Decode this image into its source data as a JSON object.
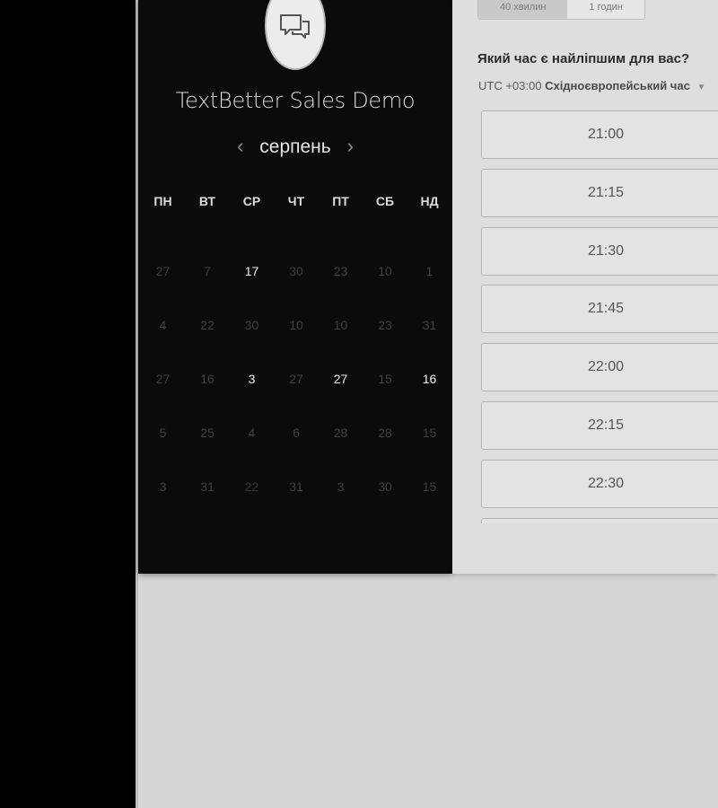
{
  "event": {
    "title": "TextBetter Sales Demo"
  },
  "calendar": {
    "month": "серпень",
    "prev_arrow": "‹",
    "next_arrow": "›",
    "weekdays": [
      "ПН",
      "ВТ",
      "СР",
      "ЧТ",
      "ПТ",
      "СБ",
      "НД"
    ],
    "weeks": [
      [
        {
          "d": "27",
          "a": false
        },
        {
          "d": "7",
          "a": false
        },
        {
          "d": "17",
          "a": true
        },
        {
          "d": "30",
          "a": false
        },
        {
          "d": "23",
          "a": false
        },
        {
          "d": "10",
          "a": false
        },
        {
          "d": "1",
          "a": false
        }
      ],
      [
        {
          "d": "4",
          "a": false
        },
        {
          "d": "22",
          "a": false
        },
        {
          "d": "30",
          "a": false
        },
        {
          "d": "10",
          "a": false
        },
        {
          "d": "10",
          "a": false
        },
        {
          "d": "23",
          "a": false
        },
        {
          "d": "31",
          "a": false
        }
      ],
      [
        {
          "d": "27",
          "a": false
        },
        {
          "d": "16",
          "a": false
        },
        {
          "d": "3",
          "a": true
        },
        {
          "d": "27",
          "a": false
        },
        {
          "d": "27",
          "a": true
        },
        {
          "d": "15",
          "a": false
        },
        {
          "d": "16",
          "a": true
        }
      ],
      [
        {
          "d": "5",
          "a": false
        },
        {
          "d": "25",
          "a": false
        },
        {
          "d": "4",
          "a": false
        },
        {
          "d": "6",
          "a": false
        },
        {
          "d": "28",
          "a": false
        },
        {
          "d": "28",
          "a": false
        },
        {
          "d": "15",
          "a": false
        }
      ],
      [
        {
          "d": "3",
          "a": false
        },
        {
          "d": "31",
          "a": false
        },
        {
          "d": "22",
          "a": true,
          "s": true
        },
        {
          "d": "31",
          "a": false
        },
        {
          "d": "3",
          "a": false
        },
        {
          "d": "30",
          "a": false
        },
        {
          "d": "15",
          "a": false
        }
      ]
    ]
  },
  "booking": {
    "durations": [
      "40 хвилин",
      "1 годин"
    ],
    "question": "Який час є найліпшим для вас?",
    "timezone_offset": "UTC +03:00",
    "timezone_name": "Східноєвропейський час",
    "slots": [
      "21:00",
      "21:15",
      "21:30",
      "21:45",
      "22:00",
      "22:15",
      "22:30",
      ""
    ]
  },
  "colors": {
    "panel_dark": "#0b0b0b",
    "panel_light": "#dedede",
    "page_bg": "#d6d6d6"
  },
  "icons": {
    "logo": "chat-bubbles-icon",
    "tz_caret": "caret-down-icon"
  }
}
